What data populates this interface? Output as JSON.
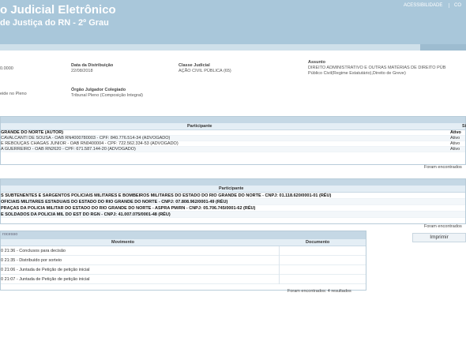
{
  "header": {
    "title": "o Judicial Eletrônico",
    "subtitle": "de Justiça do RN - 2º Grau",
    "links": [
      "ACESSIBILIDADE",
      "CO"
    ]
  },
  "details": {
    "numero_value": "0.0000",
    "data_distribuicao_label": "Data da Distribuição",
    "data_distribuicao_value": "22/08/2018",
    "classe_label": "Classe Judicial",
    "classe_value": "AÇÃO CIVIL PÚBLICA (65)",
    "assunto_label": "Assunto",
    "assunto_value_1": "DIREITO ADMINISTRATIVO E OUTRAS MATÉRIAS DE DIREITO PÚB",
    "assunto_value_2": "Público Civil(Regime Estatutário),Direito de Greve)",
    "relator_value": "eide no Pleno",
    "orgao_label": "Órgão Julgador Colegiado",
    "orgao_value": "Tribunal Pleno (Composição Integral)"
  },
  "polo_ativo": {
    "column_participante": "Participante",
    "column_situacao": "Si",
    "rows": [
      {
        "text": "GRANDE DO NORTE (AUTOR)",
        "status": "Ativo",
        "bold": true
      },
      {
        "text": "CAVALCANTI DE SOUSA - OAB RN4000780003 - CPF: 840.776.514-34 (ADVOGADO)",
        "status": "Ativo",
        "bold": false
      },
      {
        "text": "E REBOUÇAS CHAGAS JÚNIOR - OAB RN0400004 - CPF: 722.562.334-53 (ADVOGADO)",
        "status": "Ativo",
        "bold": false
      },
      {
        "text": "A GUERREIRO - OAB RN2620 - CPF: 671.587.144-20 (ADVOGADO)",
        "status": "Ativo",
        "bold": false
      }
    ],
    "footer": "Foram encontrados"
  },
  "polo_passivo": {
    "column_participante": "Participante",
    "rows": [
      {
        "text": "S SUBTENENTES E SARGENTOS POLICIAIS MILITARES E BOMBEIROS MILITARES DO ESTADO DO RIO GRANDE DO NORTE - CNPJ: 01.118.620/0001-01 (RÉU)"
      },
      {
        "text": "OFICIAIS MILITARES ESTADUAIS DO ESTADO DO RIO GRANDE DO NORTE - CNPJ: 07.808.962/0001-49 (RÉU)"
      },
      {
        "text": "PRAÇAS DA POLICIA MILITAR DO ESTADO DO RIO GRANDE DO NORTE - ASPRA PM/RN - CNPJ: 05.706.745/0001-62 (RÉU)"
      },
      {
        "text": "E SOLDADOS DA POLICIA MIL DO EST DO RGN - CNPJ: 41.007.075/0001-48 (RÉU)"
      }
    ],
    "footer": "Foram encontrados"
  },
  "actions": {
    "imprimir": "Imprimir"
  },
  "processo": {
    "label": "rocesso",
    "column_movimento": "Movimento",
    "column_documento": "Documento",
    "rows": [
      {
        "text": "0 21:36 - Conclusos para decisão"
      },
      {
        "text": "0 21:35 - Distribuído por sorteio"
      },
      {
        "text": "0 21:06 - Juntada de Petição de petição inicial"
      },
      {
        "text": "0 21:07 - Juntada de Petição de petição inicial"
      }
    ],
    "footer": "Foram encontrados: 4 resultados"
  }
}
